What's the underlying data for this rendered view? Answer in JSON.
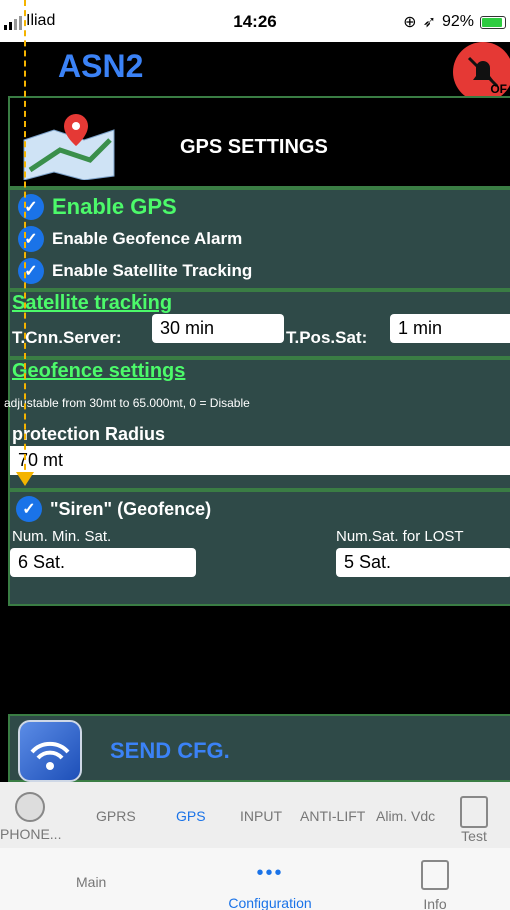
{
  "status": {
    "carrier": "Iliad",
    "time": "14:26",
    "battery": "92%"
  },
  "header": {
    "title": "ASN2",
    "alarm_state": "OF"
  },
  "gps_header": {
    "title": "GPS SETTINGS"
  },
  "enable": {
    "gps": "Enable  GPS",
    "geofence_alarm": "Enable  Geofence Alarm",
    "satellite_tracking": "Enable Satellite Tracking"
  },
  "satellite": {
    "title": "Satellite tracking",
    "cnn_label": "T.Cnn.Server:",
    "cnn_value": "30 min",
    "pos_label": "T.Pos.Sat:",
    "pos_value": "1 min"
  },
  "geofence": {
    "title": "Geofence settings",
    "hint": "adjustable from 30mt to 65.000mt, 0 = Disable",
    "radius_label": "protection Radius",
    "radius_value": "70 mt"
  },
  "siren": {
    "label": "\"Siren\" (Geofence)",
    "min_sat_label": "Num. Min. Sat.",
    "min_sat_value": "6 Sat.",
    "lost_label": "Num.Sat. for LOST",
    "lost_value": "5 Sat."
  },
  "send": {
    "label": "SEND CFG."
  },
  "tabs": [
    "PHONE...",
    "GPRS",
    "GPS",
    "INPUT",
    "ANTI-LIFT",
    "Alim. Vdc",
    "Test"
  ],
  "bottom_tabs": [
    "Main",
    "Configuration",
    "Info"
  ],
  "colors": {
    "accent": "#1a73e8",
    "green": "#4cfa6a",
    "panel": "#2f4a48"
  }
}
